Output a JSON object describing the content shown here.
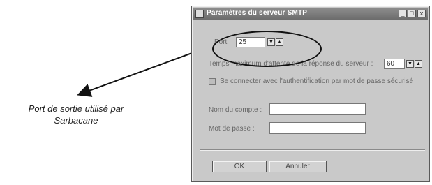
{
  "dialog": {
    "title": "Paramètres du serveur SMTP",
    "controls": {
      "minimize": "_",
      "maximize": "□",
      "close": "x"
    },
    "port": {
      "label": "Port :",
      "value": "25"
    },
    "timeout": {
      "label": "Temps maximum d'attente de la réponse du serveur :",
      "value": "60"
    },
    "auth": {
      "label": "Se connecter avec l'authentification par mot de passe sécurisé",
      "checked": false
    },
    "account": {
      "label": "Nom du compte :",
      "value": ""
    },
    "password": {
      "label": "Mot de passe :",
      "value": ""
    },
    "ok_label": "OK",
    "cancel_label": "Annuler"
  },
  "annotation": {
    "line1": "Port de sortie utilisé par",
    "line2": "Sarbacane"
  },
  "icons": {
    "spin_up": "▲",
    "spin_down": "▼"
  }
}
